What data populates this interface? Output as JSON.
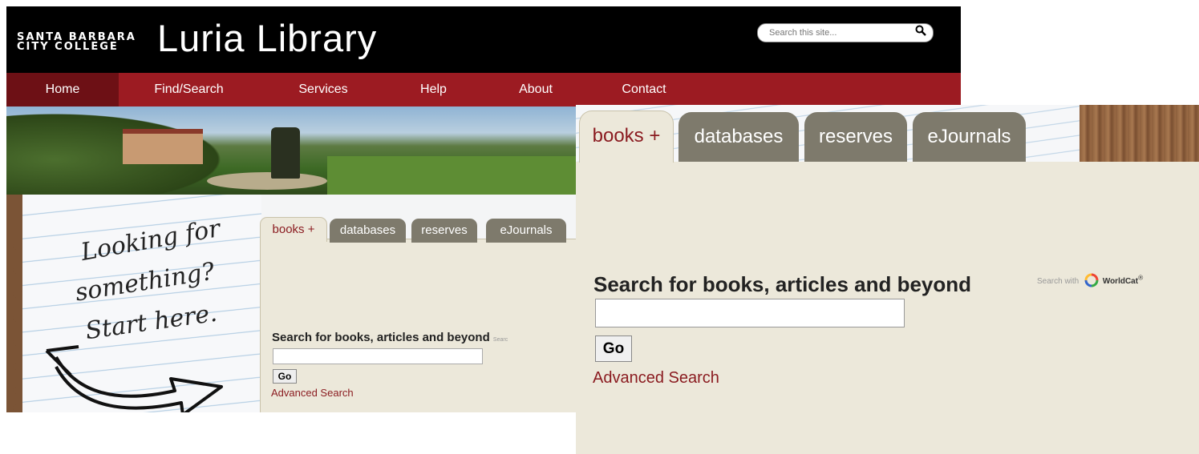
{
  "header": {
    "college_line1": "SANTA BARBARA",
    "college_line2": "CITY COLLEGE",
    "library_name": "Luria Library",
    "search_placeholder": "Search this site...",
    "search_icon": "magnifier-icon"
  },
  "nav": {
    "items": [
      "Home",
      "Find/Search",
      "Services",
      "Help",
      "About",
      "Contact"
    ],
    "active": "Home"
  },
  "notebook": {
    "line1": "Looking for",
    "line2": "something?",
    "line3": "Start here.",
    "arrow_icon": "curved-arrow-icon"
  },
  "search_widget": {
    "tabs": [
      "books +",
      "databases",
      "reserves",
      "eJournals"
    ],
    "active_tab": "books +",
    "heading": "Search for books, articles and beyond",
    "worldcat_label": "Search with",
    "worldcat_name": "WorldCat",
    "worldcat_mark": "®",
    "mini_worldcat_label": "Searc",
    "go_label": "Go",
    "advanced_link": "Advanced Search"
  },
  "colors": {
    "nav_red": "#9c1b22",
    "panel_beige": "#ece8da",
    "tab_gray": "#7e7a6c",
    "link_red": "#8a1a1f"
  }
}
